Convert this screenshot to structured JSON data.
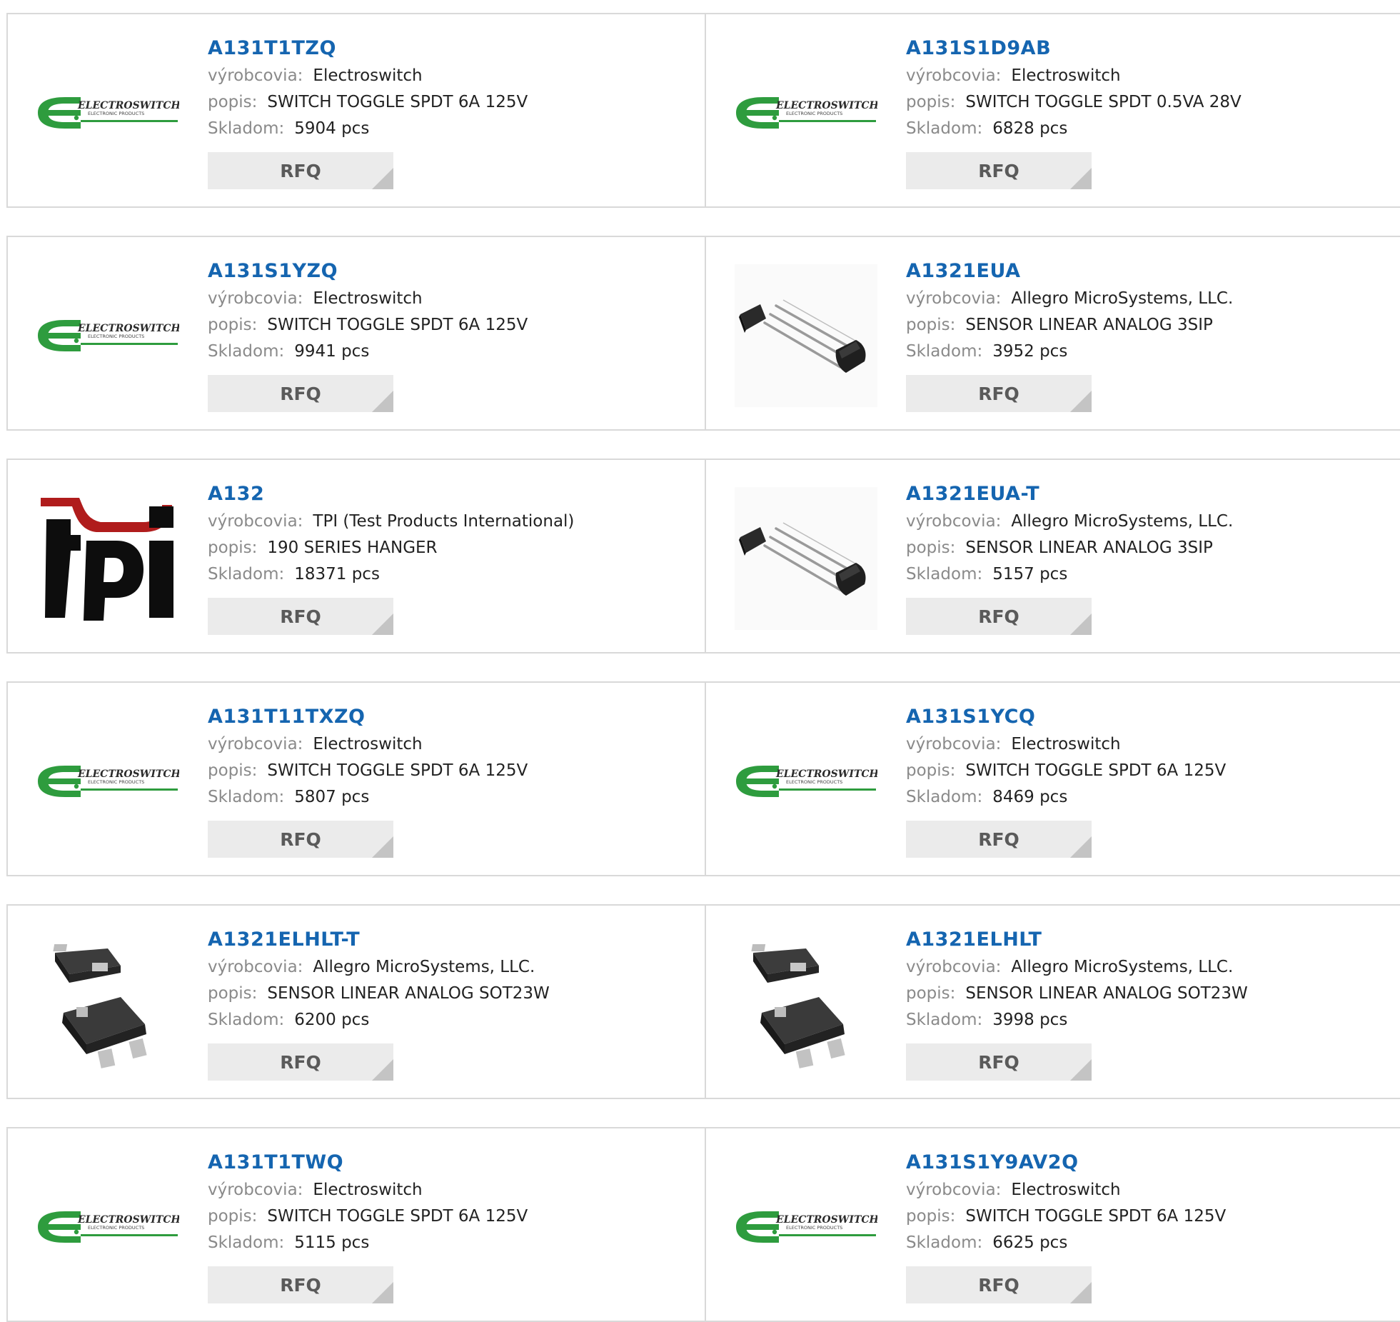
{
  "labels": {
    "manufacturer": "výrobcovia:",
    "description": "popis:",
    "stock": "Skladom:"
  },
  "rfq_label": "RFQ",
  "logos": {
    "electroswitch": {
      "name": "ELECTROSWITCH",
      "sub": "ELECTRONIC PRODUCTS",
      "color": "#2e9c3e"
    },
    "tpi": {
      "text": "tpi",
      "color": "#b01c1c"
    }
  },
  "products": [
    {
      "pn": "A131T1TZQ",
      "manufacturer": "Electroswitch",
      "description": "SWITCH TOGGLE SPDT 6A 125V",
      "stock": "5904 pcs",
      "image": "electroswitch-logo"
    },
    {
      "pn": "A131S1D9AB",
      "manufacturer": "Electroswitch",
      "description": "SWITCH TOGGLE SPDT 0.5VA 28V",
      "stock": "6828 pcs",
      "image": "electroswitch-logo"
    },
    {
      "pn": "A131S1YZQ",
      "manufacturer": "Electroswitch",
      "description": "SWITCH TOGGLE SPDT 6A 125V",
      "stock": "9941 pcs",
      "image": "electroswitch-logo"
    },
    {
      "pn": "A1321EUA",
      "manufacturer": "Allegro MicroSystems, LLC.",
      "description": "SENSOR LINEAR ANALOG 3SIP",
      "stock": "3952 pcs",
      "image": "sip3-package"
    },
    {
      "pn": "A132",
      "manufacturer": "TPI (Test Products International)",
      "description": "190 SERIES HANGER",
      "stock": "18371 pcs",
      "image": "tpi-logo"
    },
    {
      "pn": "A1321EUA-T",
      "manufacturer": "Allegro MicroSystems, LLC.",
      "description": "SENSOR LINEAR ANALOG 3SIP",
      "stock": "5157 pcs",
      "image": "sip3-package"
    },
    {
      "pn": "A131T11TXZQ",
      "manufacturer": "Electroswitch",
      "description": "SWITCH TOGGLE SPDT 6A 125V",
      "stock": "5807 pcs",
      "image": "electroswitch-logo"
    },
    {
      "pn": "A131S1YCQ",
      "manufacturer": "Electroswitch",
      "description": "SWITCH TOGGLE SPDT 6A 125V",
      "stock": "8469 pcs",
      "image": "electroswitch-logo"
    },
    {
      "pn": "A1321ELHLT-T",
      "manufacturer": "Allegro MicroSystems, LLC.",
      "description": "SENSOR LINEAR ANALOG SOT23W",
      "stock": "6200 pcs",
      "image": "sot23w-package"
    },
    {
      "pn": "A1321ELHLT",
      "manufacturer": "Allegro MicroSystems, LLC.",
      "description": "SENSOR LINEAR ANALOG SOT23W",
      "stock": "3998 pcs",
      "image": "sot23w-package"
    },
    {
      "pn": "A131T1TWQ",
      "manufacturer": "Electroswitch",
      "description": "SWITCH TOGGLE SPDT 6A 125V",
      "stock": "5115 pcs",
      "image": "electroswitch-logo"
    },
    {
      "pn": "A131S1Y9AV2Q",
      "manufacturer": "Electroswitch",
      "description": "SWITCH TOGGLE SPDT 6A 125V",
      "stock": "6625 pcs",
      "image": "electroswitch-logo"
    }
  ]
}
